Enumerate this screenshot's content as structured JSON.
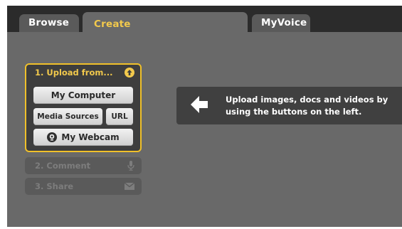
{
  "tabs": {
    "browse": "Browse",
    "create": "Create",
    "myvoice": "MyVoice"
  },
  "upload_panel": {
    "title": "1. Upload from...",
    "my_computer": "My Computer",
    "media_sources": "Media Sources",
    "url": "URL",
    "my_webcam": "My Webcam"
  },
  "steps": {
    "comment": "2. Comment",
    "share": "3. Share"
  },
  "message": {
    "text": "Upload images, docs and videos by using the buttons on the left."
  },
  "colors": {
    "accent": "#f2c94c",
    "panel_border": "#f0c02a",
    "background": "#696969"
  },
  "icons": {
    "upload": "upload-circle-icon",
    "webcam": "webcam-icon",
    "comment": "microphone-icon",
    "share": "envelope-icon",
    "message": "arrow-left-icon"
  }
}
